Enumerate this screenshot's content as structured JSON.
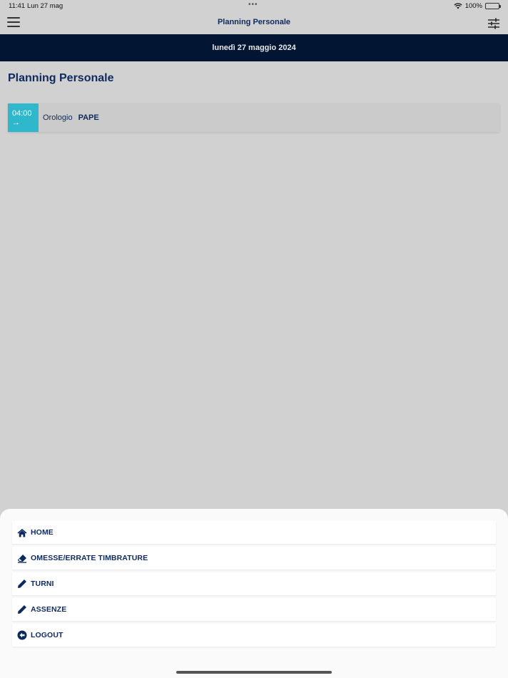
{
  "status_bar": {
    "time": "11:41",
    "date": "Lun 27 mag",
    "battery": "100%"
  },
  "nav": {
    "title": "Planning Personale"
  },
  "date_header": "lunedì 27 maggio 2024",
  "page_title": "Planning Personale",
  "events": [
    {
      "time": "04:00",
      "label": "Orologio",
      "code": "PAPE"
    }
  ],
  "menu": {
    "items": [
      {
        "label": "HOME",
        "icon": "home-icon"
      },
      {
        "label": "OMESSE/ERRATE TIMBRATURE",
        "icon": "eraser-icon"
      },
      {
        "label": "TURNI",
        "icon": "pencil-icon"
      },
      {
        "label": "ASSENZE",
        "icon": "pencil-icon"
      },
      {
        "label": "LOGOUT",
        "icon": "logout-icon"
      }
    ]
  },
  "colors": {
    "navy": "#021532",
    "accent": "#2fb7cc",
    "text": "#0d2a5e",
    "backdrop": "#d1d1d1"
  }
}
